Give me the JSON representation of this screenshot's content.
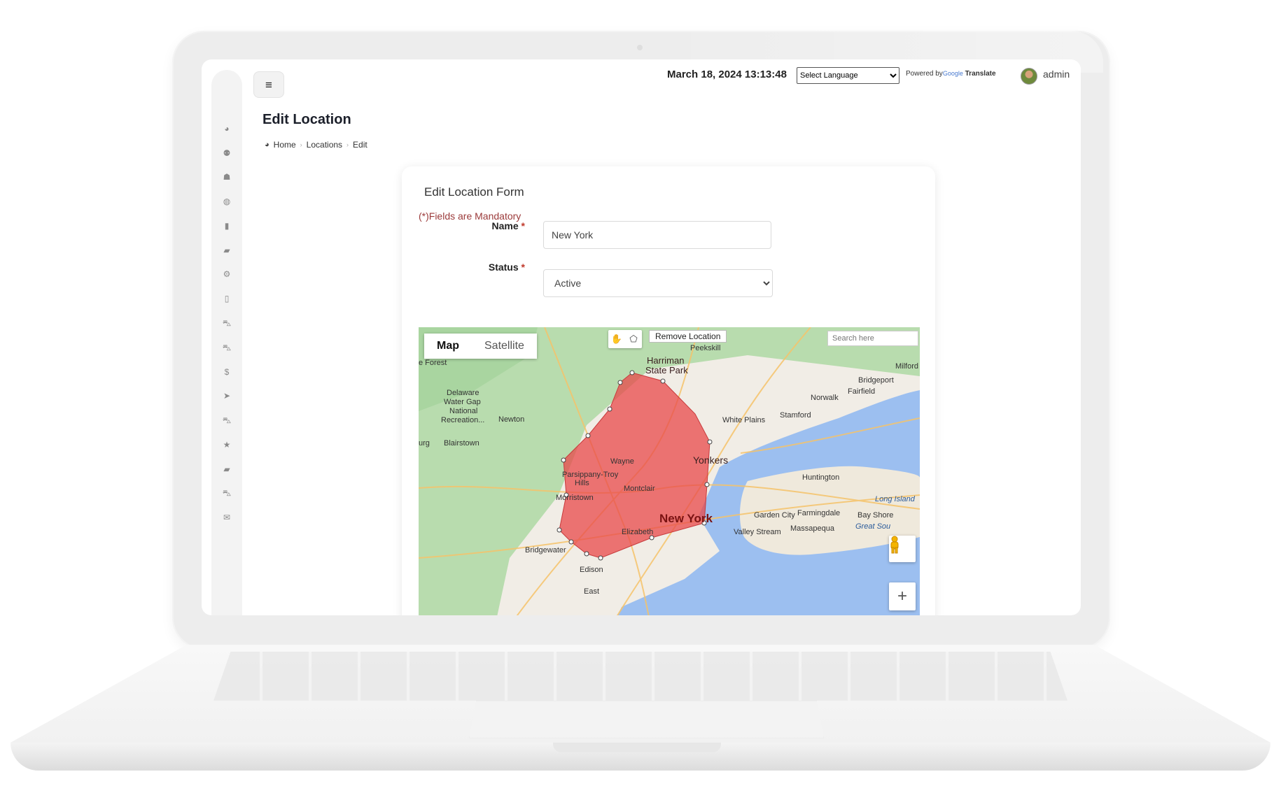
{
  "header": {
    "datetime": "March 18, 2024 13:13:48",
    "language_select": "Select Language",
    "powered_prefix": "Powered by",
    "powered_google": "Google",
    "powered_translate": "Translate",
    "username": "admin"
  },
  "page": {
    "title": "Edit Location",
    "breadcrumb": [
      "Home",
      "Locations",
      "Edit"
    ]
  },
  "sidebar": {
    "icons": [
      "dashboard-icon",
      "user-plus-icon",
      "users-icon",
      "globe-icon",
      "building-icon",
      "book-icon",
      "cogs-icon",
      "map-icon",
      "car-icon",
      "car-icon",
      "dollar-icon",
      "send-icon",
      "car-icon",
      "star-icon",
      "book-icon",
      "car-icon",
      "envelope-icon"
    ]
  },
  "form": {
    "title": "Edit Location Form",
    "mandatory_note": "(*)Fields are Mandatory",
    "name_label": "Name",
    "name_value": "New York",
    "status_label": "Status",
    "status_value": "Active",
    "required_mark": "*"
  },
  "map": {
    "type_buttons": [
      "Map",
      "Satellite"
    ],
    "active_type": "Map",
    "remove_button": "Remove Location",
    "search_placeholder": "Search here",
    "zoom_in": "+",
    "polygon_color": "#e8484a",
    "labels": {
      "harriman": "Harriman",
      "state_park": "State Park",
      "peekskill": "Peekskill",
      "milford": "Milford",
      "bridgeport": "Bridgeport",
      "fairfield": "Fairfield",
      "norwalk": "Norwalk",
      "stamford": "Stamford",
      "white_plains": "White Plains",
      "forest": "e Forest",
      "delaware_1": "Delaware",
      "delaware_2": "Water Gap",
      "delaware_3": "National",
      "delaware_4": "Recreation...",
      "newton": "Newton",
      "blairstown": "Blairstown",
      "urg": "urg",
      "wayne": "Wayne",
      "yonkers": "Yonkers",
      "parsippany": "Parsippany-Troy",
      "hills": "Hills",
      "montclair": "Montclair",
      "morristown": "Morristown",
      "huntington": "Huntington",
      "long_island": "Long Island",
      "garden_city": "Garden City",
      "farmingdale": "Farmingdale",
      "bay_shore": "Bay Shore",
      "new_york": "New York",
      "elizabeth": "Elizabeth",
      "valley_stream": "Valley Stream",
      "massapequa": "Massapequa",
      "great_south": "Great Sou",
      "bridgewater": "Bridgewater",
      "edison": "Edison",
      "east": "East"
    }
  }
}
